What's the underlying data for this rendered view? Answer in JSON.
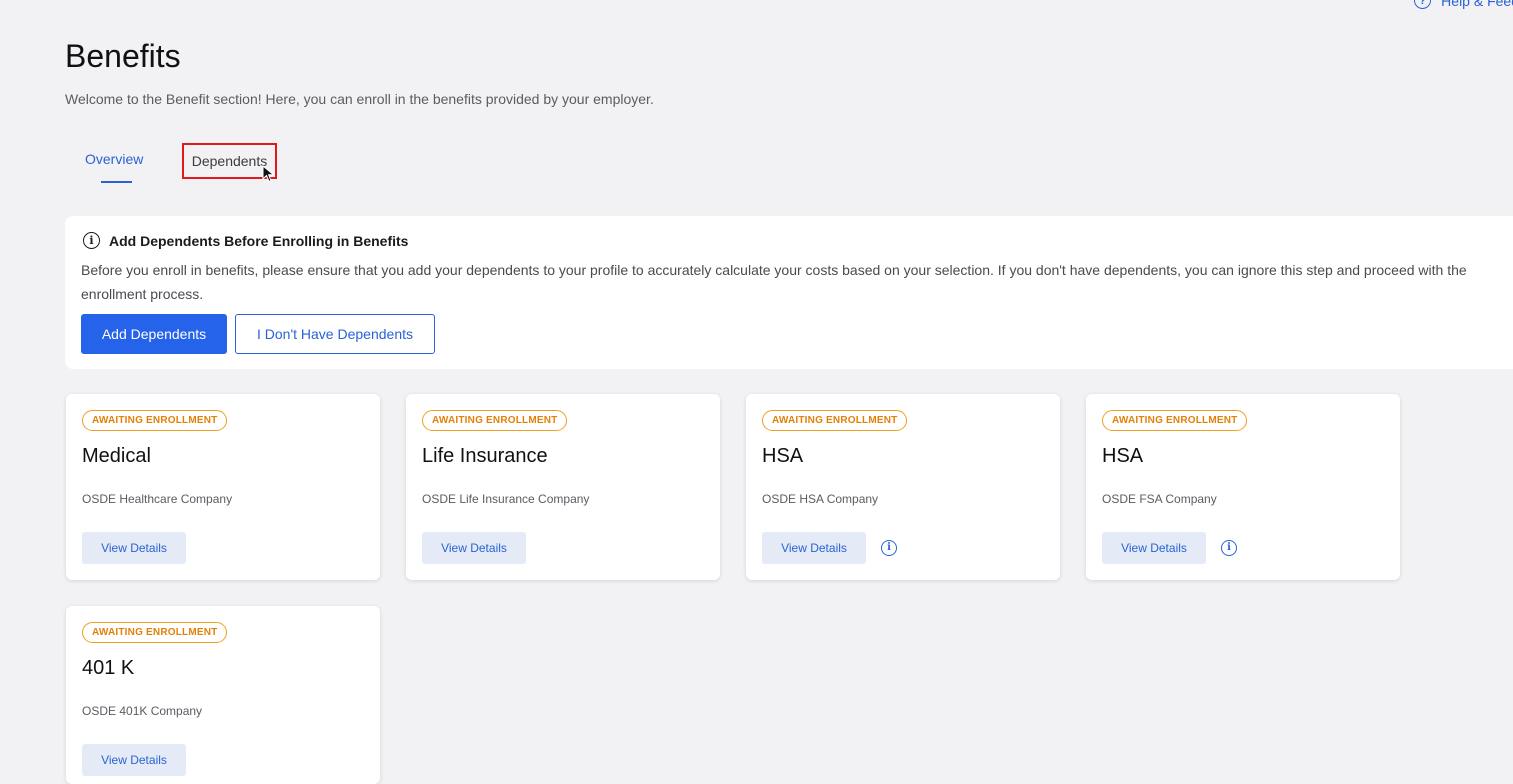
{
  "header": {
    "help_label": "Help & Feed",
    "title": "Benefits",
    "subtitle": "Welcome to the Benefit section! Here, you can enroll in the benefits provided by your employer."
  },
  "tabs": [
    {
      "label": "Overview",
      "active": true
    },
    {
      "label": "Dependents",
      "active": false
    }
  ],
  "notice": {
    "title": "Add Dependents Before Enrolling in Benefits",
    "body": "Before you enroll in benefits, please ensure that you add your dependents to your profile to accurately calculate your costs based on your selection. If you don't have dependents, you can ignore this step and proceed with the enrollment process.",
    "primary_button": "Add Dependents",
    "secondary_button": "I Don't Have Dependents"
  },
  "cards": [
    {
      "badge": "AWAITING ENROLLMENT",
      "title": "Medical",
      "company": "OSDE Healthcare Company",
      "button": "View Details",
      "info_icon": false
    },
    {
      "badge": "AWAITING ENROLLMENT",
      "title": "Life Insurance",
      "company": "OSDE Life Insurance Company",
      "button": "View Details",
      "info_icon": false
    },
    {
      "badge": "AWAITING ENROLLMENT",
      "title": "HSA",
      "company": "OSDE HSA Company",
      "button": "View Details",
      "info_icon": true
    },
    {
      "badge": "AWAITING ENROLLMENT",
      "title": "HSA",
      "company": "OSDE FSA Company",
      "button": "View Details",
      "info_icon": true
    },
    {
      "badge": "AWAITING ENROLLMENT",
      "title": "401 K",
      "company": "OSDE 401K Company",
      "button": "View Details",
      "info_icon": false
    }
  ],
  "colors": {
    "accent": "#2563eb",
    "badge": "#e0820a",
    "highlight": "#e0191f",
    "background": "#f2f1f4"
  }
}
